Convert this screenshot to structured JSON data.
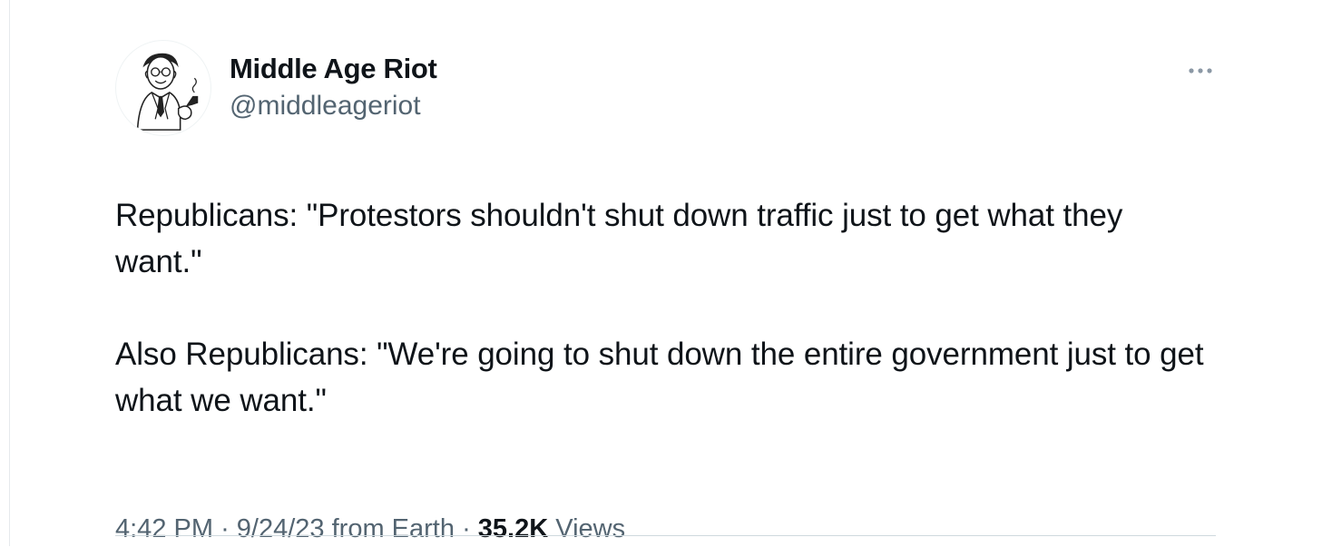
{
  "tweet": {
    "author": {
      "display_name": "Middle Age Riot",
      "handle": "@middleageriot",
      "avatar_icon": "pipe-smoking-man-illustration"
    },
    "more_icon": "ellipsis-icon",
    "text": "Republicans: \"Protestors shouldn't shut down traffic just to get what they want.\"\n\nAlso Republicans: \"We're going to shut down the entire government just to get what we want.\"",
    "meta": {
      "time": "4:42 PM",
      "separator": "·",
      "date": "9/24/23",
      "source": "from Earth",
      "views_count": "35.2K",
      "views_label": "Views"
    }
  },
  "colors": {
    "text_primary": "#0f1419",
    "text_secondary": "#536471",
    "divider": "#cfd9de"
  }
}
